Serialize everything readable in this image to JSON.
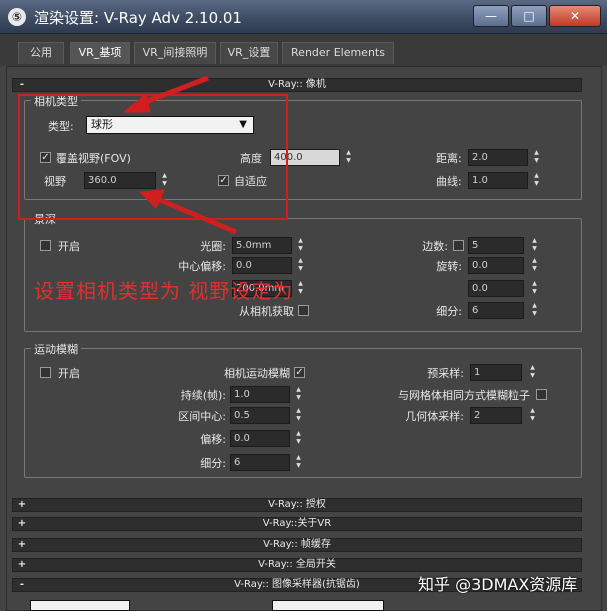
{
  "window": {
    "title": "渲染设置: V-Ray Adv 2.10.01",
    "minimize": "—",
    "maximize": "□",
    "close": "✕"
  },
  "tabs": [
    "公用",
    "VR_基项",
    "VR_间接照明",
    "VR_设置",
    "Render Elements"
  ],
  "camera_rollout": {
    "sign": "-",
    "title": "V-Ray:: 像机",
    "camera_type": {
      "group_title": "相机类型",
      "type_label": "类型:",
      "type_value": "球形",
      "fov_label": "覆盖视野(FOV)",
      "fov_checked": true,
      "view_label": "视野",
      "view_value": "360.0",
      "height_label": "高度",
      "height_value": "400.0",
      "auto_fit_label": "自适应",
      "auto_fit_checked": true,
      "distance_label": "距离:",
      "distance_value": "2.0",
      "curve_label": "曲线:",
      "curve_value": "1.0"
    },
    "dof": {
      "group_title": "景深",
      "on_label": "开启",
      "aperture_label": "光圈:",
      "aperture_value": "5.0mm",
      "center_bias_label": "中心偏移:",
      "center_bias_value": "0.0",
      "focal_value": "200.0mm",
      "from_camera_label": "从相机获取",
      "sides_label": "边数:",
      "sides_value": "5",
      "rotation_label": "旋转:",
      "rotation_value": "0.0",
      "anisotropy_value": "0.0",
      "subdivs_label": "细分:",
      "subdivs_value": "6"
    },
    "motion_blur": {
      "group_title": "运动模糊",
      "on_label": "开启",
      "camera_mb_label": "相机运动模糊",
      "camera_mb_checked": true,
      "duration_label": "持续(帧):",
      "duration_value": "1.0",
      "interval_center_label": "区间中心:",
      "interval_center_value": "0.5",
      "bias_label": "偏移:",
      "bias_value": "0.0",
      "subdivs_label": "细分:",
      "subdivs_value": "6",
      "prepass_label": "预采样:",
      "prepass_value": "1",
      "particles_label": "与网格体相同方式模糊粒子",
      "geom_samples_label": "几何体采样:",
      "geom_samples_value": "2"
    }
  },
  "annotation_text": "设置相机类型为                视野设定为",
  "collapsed_rollouts": [
    {
      "sign": "+",
      "title": "V-Ray:: 授权"
    },
    {
      "sign": "+",
      "title": "V-Ray::关于VR"
    },
    {
      "sign": "+",
      "title": "V-Ray:: 帧缓存"
    },
    {
      "sign": "+",
      "title": "V-Ray:: 全局开关"
    },
    {
      "sign": "-",
      "title": "V-Ray:: 图像采样器(抗锯齿)"
    }
  ],
  "watermark": "知乎 @3DMAX资源库",
  "colors": {
    "annotation": "#d11f1f",
    "panel": "#444444"
  }
}
